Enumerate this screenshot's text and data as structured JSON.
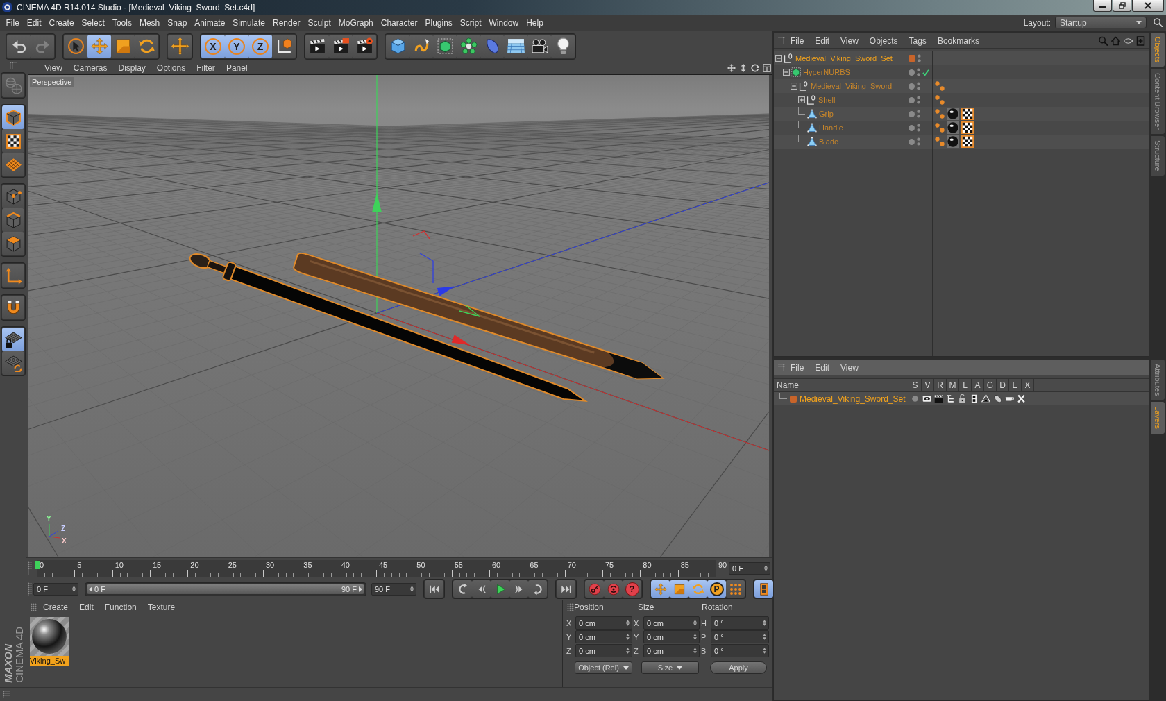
{
  "window": {
    "title": "CINEMA 4D R14.014 Studio - [Medieval_Viking_Sword_Set.c4d]"
  },
  "menu_bar": {
    "items": [
      "File",
      "Edit",
      "Create",
      "Select",
      "Tools",
      "Mesh",
      "Snap",
      "Animate",
      "Simulate",
      "Render",
      "Sculpt",
      "MoGraph",
      "Character",
      "Plugins",
      "Script",
      "Window",
      "Help"
    ],
    "layout_label": "Layout:",
    "layout_value": "Startup"
  },
  "toolbar": {
    "groups": [
      {
        "items": [
          {
            "kind": "undo",
            "selected": false,
            "disabled": false
          },
          {
            "kind": "redo",
            "selected": false,
            "disabled": true
          }
        ]
      },
      {
        "items": [
          {
            "kind": "select",
            "selected": false,
            "disabled": false
          },
          {
            "kind": "move",
            "selected": true,
            "disabled": false
          },
          {
            "kind": "scale",
            "selected": false,
            "disabled": false
          },
          {
            "kind": "rotate",
            "selected": false,
            "disabled": false
          }
        ]
      },
      {
        "items": [
          {
            "kind": "recent",
            "selected": false,
            "disabled": false
          }
        ]
      },
      {
        "items": [
          {
            "kind": "axis-lock",
            "label": "X",
            "selected": true,
            "disabled": false
          },
          {
            "kind": "axis-lock",
            "label": "Y",
            "selected": true,
            "disabled": false
          },
          {
            "kind": "axis-lock",
            "label": "Z",
            "selected": true,
            "disabled": false
          },
          {
            "kind": "coord-system",
            "selected": false,
            "disabled": false
          }
        ]
      },
      {
        "items": [
          {
            "kind": "render-view",
            "selected": false,
            "disabled": false
          },
          {
            "kind": "render-picture",
            "selected": false,
            "disabled": false
          },
          {
            "kind": "render-settings",
            "selected": false,
            "disabled": false
          }
        ]
      },
      {
        "items": [
          {
            "kind": "cube",
            "selected": false,
            "disabled": false
          },
          {
            "kind": "spline",
            "selected": false,
            "disabled": false
          },
          {
            "kind": "subdivision",
            "selected": false,
            "disabled": false
          },
          {
            "kind": "cloner",
            "selected": false,
            "disabled": false
          },
          {
            "kind": "deformer",
            "selected": false,
            "disabled": false
          },
          {
            "kind": "floor",
            "selected": false,
            "disabled": false
          },
          {
            "kind": "camera",
            "selected": false,
            "disabled": false
          },
          {
            "kind": "light",
            "selected": false,
            "disabled": false
          }
        ]
      }
    ]
  },
  "left_toolbar": {
    "groups": [
      {
        "items": [
          {
            "kind": "make-editable",
            "selected": false,
            "disabled": true
          }
        ]
      },
      {
        "items": [
          {
            "kind": "model",
            "selected": true,
            "disabled": false
          },
          {
            "kind": "texture",
            "selected": false,
            "disabled": false
          },
          {
            "kind": "workplane",
            "selected": false,
            "disabled": false
          }
        ]
      },
      {
        "items": [
          {
            "kind": "points",
            "selected": false,
            "disabled": false
          },
          {
            "kind": "edges",
            "selected": false,
            "disabled": false
          },
          {
            "kind": "polygons",
            "selected": false,
            "disabled": false
          }
        ]
      },
      {
        "items": [
          {
            "kind": "axis",
            "selected": false,
            "disabled": false
          }
        ]
      },
      {
        "items": [
          {
            "kind": "snap",
            "selected": false,
            "disabled": false
          }
        ]
      },
      {
        "items": [
          {
            "kind": "lock-workplane",
            "selected": true,
            "disabled": false
          },
          {
            "kind": "align-workplane",
            "selected": false,
            "disabled": false
          }
        ]
      }
    ]
  },
  "viewport": {
    "menu": [
      "View",
      "Cameras",
      "Display",
      "Options",
      "Filter",
      "Panel"
    ],
    "camera": "Perspective",
    "axis_labels": {
      "y": "Y",
      "z": "Z",
      "x": "X"
    }
  },
  "timeline": {
    "ticks": [
      "0",
      "5",
      "10",
      "15",
      "20",
      "25",
      "30",
      "35",
      "40",
      "45",
      "50",
      "55",
      "60",
      "65",
      "70",
      "75",
      "80",
      "85",
      "90"
    ],
    "playhead": {
      "level": 0
    },
    "current_frame": "0 F"
  },
  "transport": {
    "start_field": "0 F",
    "range": {
      "start_label": "0 F",
      "end_label": "90 F",
      "level": 1
    },
    "end_field": "90 F",
    "groups": [
      {
        "items": [
          {
            "kind": "go-start",
            "selected": false
          }
        ]
      },
      {
        "items": [
          {
            "kind": "prev-key",
            "selected": false
          },
          {
            "kind": "prev-frame",
            "selected": false
          },
          {
            "kind": "play",
            "selected": false
          },
          {
            "kind": "next-frame",
            "selected": false
          },
          {
            "kind": "next-key",
            "selected": false
          }
        ]
      },
      {
        "items": [
          {
            "kind": "go-end",
            "selected": false
          }
        ]
      },
      {
        "items": [
          {
            "kind": "record",
            "selected": false
          },
          {
            "kind": "autokey",
            "selected": false
          },
          {
            "kind": "keyframe-selection",
            "label": "?",
            "selected": false
          }
        ]
      },
      {
        "items": [
          {
            "kind": "key-position",
            "selected": true
          },
          {
            "kind": "key-scale",
            "selected": true
          },
          {
            "kind": "key-rotation",
            "selected": true
          },
          {
            "kind": "key-parameter",
            "label": "P",
            "selected": true
          },
          {
            "kind": "key-points",
            "selected": false
          }
        ]
      },
      {
        "items": [
          {
            "kind": "timeline-window",
            "selected": true
          }
        ]
      }
    ]
  },
  "materials": {
    "menu": [
      "Create",
      "Edit",
      "Function",
      "Texture"
    ],
    "items": [
      {
        "name": "Viking_Sw",
        "selected": true
      }
    ]
  },
  "coordinates": {
    "headers": [
      "Position",
      "Size",
      "Rotation"
    ],
    "rows": [
      {
        "position_axis": "X",
        "position": "0 cm",
        "size_axis": "X",
        "size": "0 cm",
        "rotation_axis": "H",
        "rotation": "0 °"
      },
      {
        "position_axis": "Y",
        "position": "0 cm",
        "size_axis": "Y",
        "size": "0 cm",
        "rotation_axis": "P",
        "rotation": "0 °"
      },
      {
        "position_axis": "Z",
        "position": "0 cm",
        "size_axis": "Z",
        "size": "0 cm",
        "rotation_axis": "B",
        "rotation": "0 °"
      }
    ],
    "mode": "Object (Rel)",
    "size_mode": "Size",
    "apply": "Apply"
  },
  "objects": {
    "menu": [
      "File",
      "Edit",
      "View",
      "Objects",
      "Tags",
      "Bookmarks"
    ],
    "items": [
      {
        "name": "Medieval_Viking_Sword_Set",
        "kind": "null",
        "selected": true,
        "active": true,
        "expanded": true,
        "color": "#c8642a",
        "children": [
          {
            "name": "HyperNURBS",
            "kind": "subdivision",
            "selected": true,
            "active": false,
            "expanded": true,
            "enabled": true,
            "children": [
              {
                "name": "Medieval_Viking_Sword",
                "kind": "null",
                "selected": true,
                "active": false,
                "expanded": true,
                "tags": [
                  {
                    "kind": "phong"
                  }
                ],
                "children": [
                  {
                    "name": "Shell",
                    "kind": "null",
                    "selected": true,
                    "active": false,
                    "expanded": false,
                    "tags": [
                      {
                        "kind": "phong"
                      }
                    ]
                  },
                  {
                    "name": "Grip",
                    "kind": "polygon",
                    "selected": true,
                    "active": false,
                    "tags": [
                      {
                        "kind": "phong"
                      },
                      {
                        "kind": "material"
                      },
                      {
                        "kind": "uvw"
                      }
                    ]
                  },
                  {
                    "name": "Handle",
                    "kind": "polygon",
                    "selected": true,
                    "active": false,
                    "tags": [
                      {
                        "kind": "phong"
                      },
                      {
                        "kind": "material"
                      },
                      {
                        "kind": "uvw"
                      }
                    ]
                  },
                  {
                    "name": "Blade",
                    "kind": "polygon",
                    "selected": true,
                    "active": false,
                    "tags": [
                      {
                        "kind": "phong"
                      },
                      {
                        "kind": "material"
                      },
                      {
                        "kind": "uvw"
                      }
                    ]
                  }
                ]
              }
            ]
          }
        ]
      }
    ]
  },
  "layers": {
    "menu": [
      "File",
      "Edit",
      "View"
    ],
    "columns": [
      "Name",
      "S",
      "V",
      "R",
      "M",
      "L",
      "A",
      "G",
      "D",
      "E",
      "X"
    ],
    "items": [
      {
        "name": "Medieval_Viking_Sword_Set",
        "color": "#c8642a",
        "flags": {
          "solo": false,
          "view": true,
          "render": true,
          "manager": true,
          "locked": false,
          "animation": true,
          "generators": true,
          "deformers": true,
          "expressions": true,
          "xrefs": true
        }
      }
    ]
  },
  "side_tabs": {
    "top": [
      {
        "label": "Objects",
        "selected": true
      },
      {
        "label": "Content Browser",
        "selected": false
      },
      {
        "label": "Structure",
        "selected": false
      }
    ],
    "bottom": [
      {
        "label": "Attributes",
        "selected": false
      },
      {
        "label": "Layers",
        "selected": true
      }
    ]
  },
  "logo": {
    "brand": "MAXON",
    "product": "CINEMA 4D"
  }
}
